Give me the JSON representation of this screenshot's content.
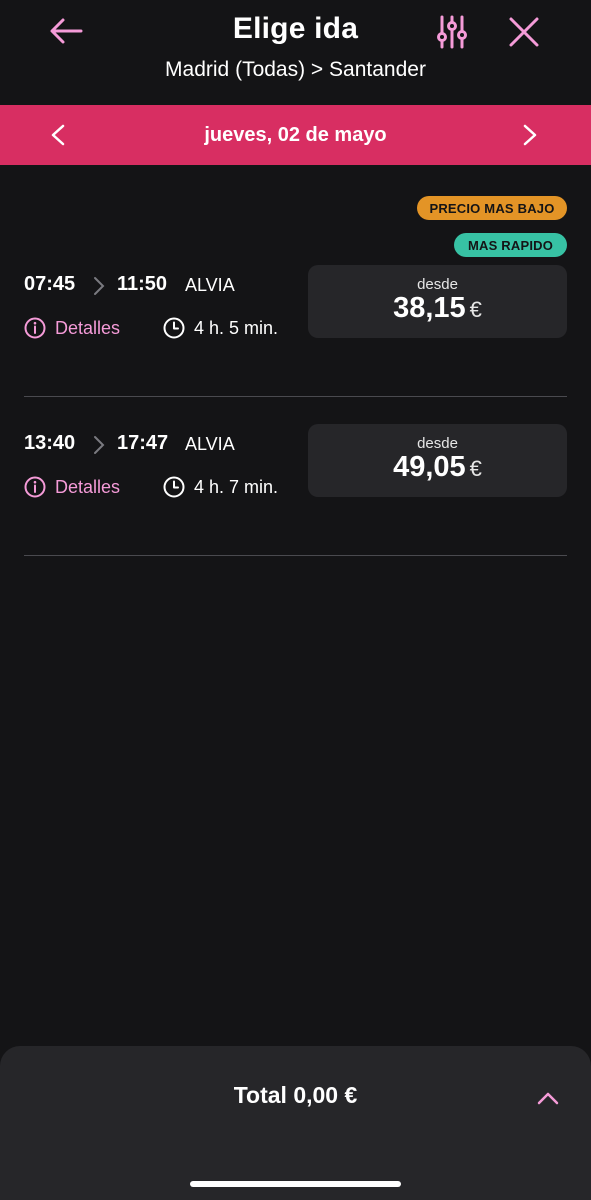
{
  "header": {
    "title": "Elige ida",
    "route": "Madrid (Todas) > Santander",
    "icons": {
      "back": "arrow-left-icon",
      "filter": "sliders-icon",
      "close": "close-icon"
    }
  },
  "date_bar": {
    "date": "jueves, 02 de mayo",
    "icons": {
      "prev": "chevron-left-icon",
      "next": "chevron-right-icon"
    }
  },
  "badges": {
    "cheapest": "PRECIO MAS BAJO",
    "fastest": "MAS RAPIDO"
  },
  "trips": [
    {
      "departure": "07:45",
      "arrival": "11:50",
      "train": "ALVIA",
      "details_label": "Detalles",
      "duration": "4 h. 5 min.",
      "price_prefix": "desde",
      "price": "38,15",
      "currency": "€"
    },
    {
      "departure": "13:40",
      "arrival": "17:47",
      "train": "ALVIA",
      "details_label": "Detalles",
      "duration": "4 h. 7 min.",
      "price_prefix": "desde",
      "price": "49,05",
      "currency": "€"
    }
  ],
  "bottom": {
    "total": "Total 0,00 €"
  },
  "colors": {
    "background": "#141416",
    "accent_pink": "#d82e62",
    "link_pink": "#f59bd8",
    "badge_orange": "#e39426",
    "badge_teal": "#37c2a4",
    "card": "#262629"
  }
}
